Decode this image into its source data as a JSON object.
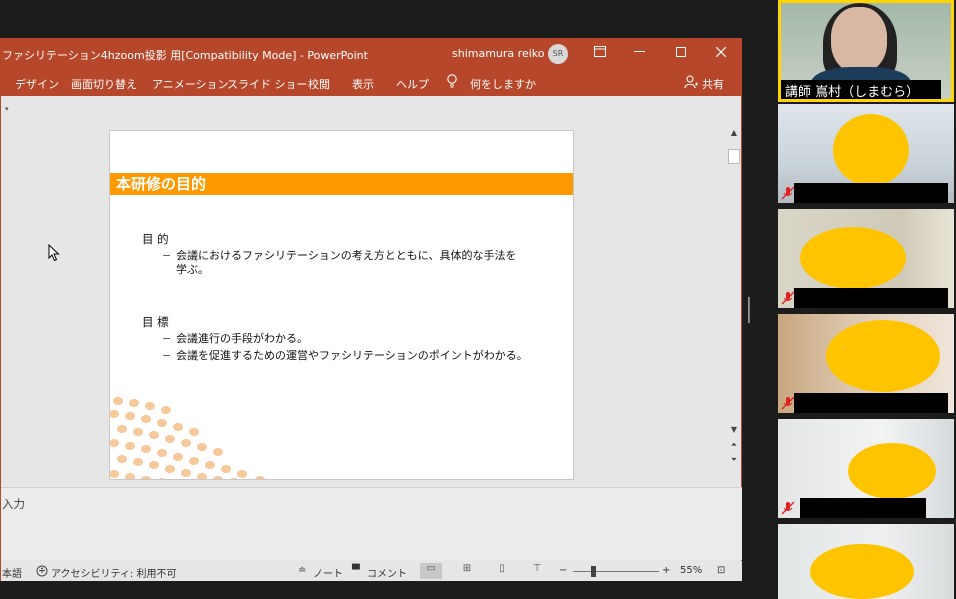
{
  "window": {
    "title": "ファシリテーション4hzoom投影 用[Compatibility Mode]  -  PowerPoint",
    "user_name": "shimamura reiko",
    "user_initials": "SR"
  },
  "ribbon": {
    "tabs": [
      "デザイン",
      "画面切り替え",
      "アニメーション",
      "スライド ショー",
      "校閲",
      "表示",
      "ヘルプ"
    ],
    "tell_me": "何をしますか",
    "share": "共有"
  },
  "slide": {
    "title": "本研修の目的",
    "purpose_heading": "目 的",
    "purpose_items": [
      "会議におけるファシリテーションの考え方とともに、具体的な手法を",
      "学ぶ。"
    ],
    "goal_heading": "目 標",
    "goal_items": [
      "会議進行の手段がわかる。",
      "会議を促進するための運営やファシリテーションのポイントがわかる。"
    ],
    "bullet": "−"
  },
  "notes": {
    "placeholder": "入力"
  },
  "status_bar": {
    "language": "本語",
    "accessibility": "アクセシビリティ: 利用不可",
    "notes_label": "ノート",
    "comments_label": "コメント",
    "zoom_minus": "−",
    "zoom_plus": "+",
    "zoom_level": "55%"
  },
  "gallery": {
    "speaker_name": "講師  嶌村（しまむら）"
  },
  "icons": {
    "restore": "restore-icon",
    "minimize": "minimize-icon",
    "maximize": "maximize-icon",
    "close": "close-icon",
    "lightbulb": "lightbulb-icon",
    "share": "person-icon",
    "muted_mic": "muted-mic-icon"
  },
  "colors": {
    "ppt_accent": "#b7472a",
    "slide_title_bar": "#ff9900",
    "active_speaker_border": "#ffd400",
    "face_mask": "#ffc400",
    "muted_mic": "#e02020"
  }
}
